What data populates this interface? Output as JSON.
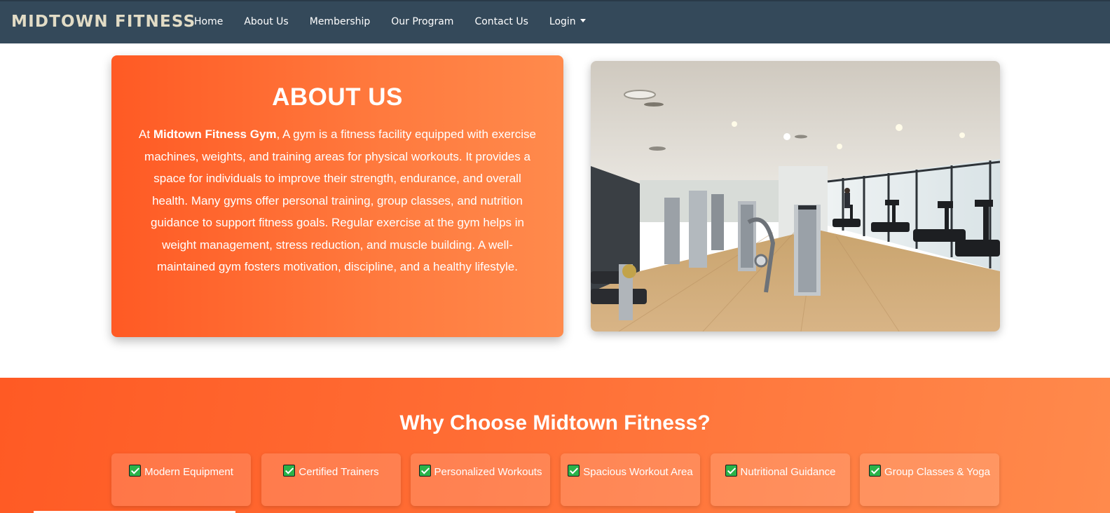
{
  "brand": "MIDTOWN FITNESS",
  "nav": {
    "items": [
      "Home",
      "About Us",
      "Membership",
      "Our Program",
      "Contact Us"
    ],
    "login": "Login"
  },
  "about": {
    "title": "ABOUT US",
    "intro": "At ",
    "brand_name": "Midtown Fitness Gym",
    "text": ", A gym is a fitness facility equipped with exercise machines, weights, and training areas for physical workouts. It provides a space for individuals to improve their strength, endurance, and overall health. Many gyms offer personal training, group classes, and nutrition guidance to support fitness goals. Regular exercise at the gym helps in weight management, stress reduction, and muscle building. A well-maintained gym fosters motivation, discipline, and a healthy lifestyle."
  },
  "why": {
    "title": "Why Choose Midtown Fitness?",
    "features": [
      "Modern Equipment",
      "Certified Trainers",
      "Personalized Workouts",
      "Spacious Workout Area",
      "Nutritional Guidance",
      "Group Classes & Yoga"
    ]
  },
  "colors": {
    "navbar": "#34495a",
    "brand_text": "#e2dcc6",
    "accent_orange": "#ff6a30",
    "check_green": "#2ab34a"
  },
  "icons": {
    "check": "check-box-icon",
    "login_caret": "chevron-down-icon"
  }
}
